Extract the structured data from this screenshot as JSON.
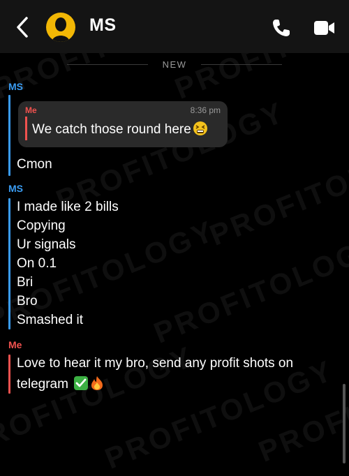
{
  "header": {
    "title": "MS",
    "back_icon": "chevron-left-icon",
    "call_icon": "phone-icon",
    "video_icon": "video-camera-icon"
  },
  "divider": {
    "label": "NEW"
  },
  "messages": {
    "group1": {
      "sender": "MS",
      "quote": {
        "sender": "Me",
        "time": "8:36 pm",
        "text": "We catch those round here"
      },
      "lines": [
        "Cmon"
      ]
    },
    "group2": {
      "sender": "MS",
      "lines": [
        "I made like 2 bills",
        "Copying",
        "Ur signals",
        "On 0.1",
        "Bri",
        "Bro",
        "Smashed it"
      ]
    },
    "group3": {
      "sender": "Me",
      "lines": [
        "Love to hear it my bro, send any profit shots on",
        "telegram"
      ]
    }
  },
  "watermark": {
    "text": "PROFITOLOGY"
  },
  "colors": {
    "background": "#000000",
    "header": "#141414",
    "friend": "#3a9cf2",
    "me": "#f0524f",
    "bubble": "#2a2a2a"
  }
}
